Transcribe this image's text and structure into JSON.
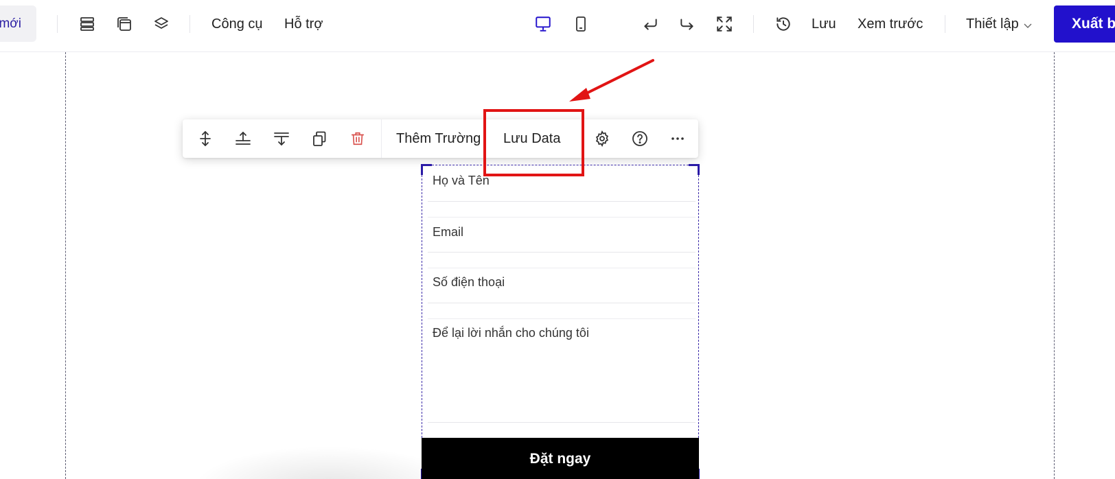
{
  "toolbar": {
    "new_label": "mới",
    "menu_tools": "Công cụ",
    "menu_support": "Hỗ trợ",
    "save_label": "Lưu",
    "preview_label": "Xem trước",
    "settings_label": "Thiết lập",
    "publish_label": "Xuất bản",
    "active_device": "desktop",
    "icons": [
      "sections-icon",
      "pages-icon",
      "layers-icon",
      "desktop-icon",
      "mobile-icon",
      "undo-icon",
      "redo-icon",
      "fullscreen-icon",
      "history-icon"
    ]
  },
  "element_toolbar": {
    "add_field_label": "Thêm Trường",
    "save_data_label": "Lưu Data",
    "icons": [
      "resize-vertical-icon",
      "move-up-icon",
      "move-down-icon",
      "duplicate-icon",
      "trash-icon",
      "gear-icon",
      "help-icon",
      "more-icon"
    ]
  },
  "form": {
    "fields": [
      {
        "placeholder": "Họ và Tên"
      },
      {
        "placeholder": "Email"
      },
      {
        "placeholder": "Số điện thoại"
      },
      {
        "placeholder": "Để lại lời nhắn cho chúng tôi"
      }
    ],
    "submit_label": "Đặt ngay"
  },
  "colors": {
    "brand": "#2211cc",
    "annotation": "#e11414",
    "delete": "#d9534f"
  }
}
